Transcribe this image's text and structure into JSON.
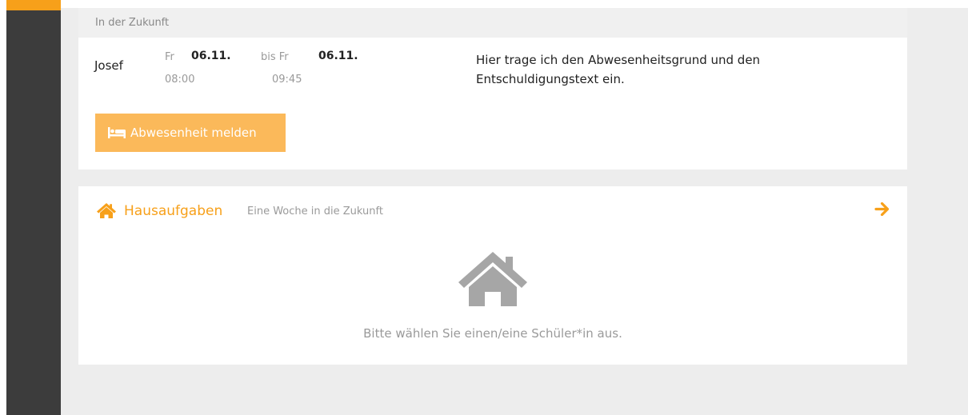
{
  "absence": {
    "header": "In der Zukunft",
    "entries": [
      {
        "name": "Josef",
        "from_day": "Fr",
        "from_date": "06.11.",
        "from_time": "08:00",
        "to_day": "bis Fr",
        "to_date": "06.11.",
        "to_time": "09:45",
        "reason": "Hier trage ich den Abwesenheitsgrund und den Entschuldigungstext ein."
      }
    ],
    "report_button": "Abwesenheit melden",
    "report_icon": "bed-icon"
  },
  "homework": {
    "title": "Hausaufgaben",
    "subtitle": "Eine Woche in die Zukunft",
    "title_icon": "home-icon",
    "arrow_icon": "arrow-right-icon",
    "empty_icon": "home-icon",
    "empty_text": "Bitte wählen Sie einen/eine Schüler*in aus."
  },
  "colors": {
    "accent": "#f7a01a",
    "button": "#fbb95a",
    "sidebar": "#3c3c3c",
    "background": "#ededed"
  }
}
